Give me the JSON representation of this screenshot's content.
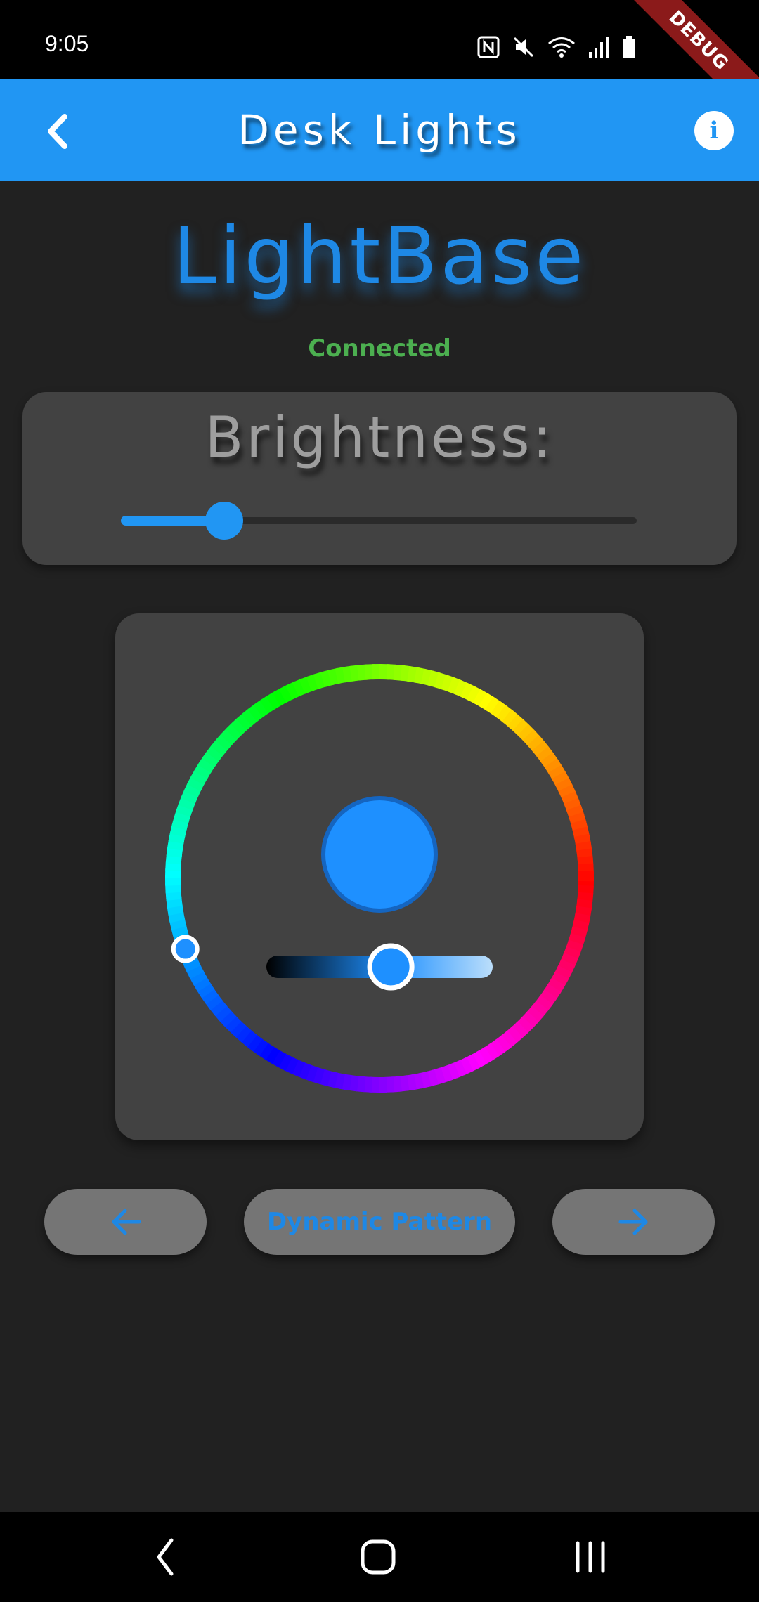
{
  "status_bar": {
    "time": "9:05",
    "icons": [
      "nfc-icon",
      "mute-icon",
      "wifi-icon",
      "signal-icon",
      "battery-icon"
    ],
    "debug_label": "DEBUG"
  },
  "app_bar": {
    "title": "Desk Lights",
    "back_icon": "chevron-left-icon",
    "info_icon": "info-icon",
    "info_glyph": "i",
    "background": "#2196f3"
  },
  "main": {
    "brand_title": "LightBase",
    "brand_color": "#1e88e5",
    "connection_status": "Connected",
    "status_color": "#4caf50"
  },
  "brightness": {
    "label": "Brightness:",
    "value": 0.2
  },
  "color_picker": {
    "hue_wheel": true,
    "selected_hue_deg": 200,
    "preview_color": "#1e90ff",
    "shade_value": 0.55
  },
  "buttons": {
    "prev_icon": "arrow-left-icon",
    "pattern_label": "Dynamic Pattern",
    "next_icon": "arrow-right-icon"
  },
  "nav_bar": {
    "icons": [
      "back-nav-icon",
      "home-nav-icon",
      "recents-nav-icon"
    ]
  }
}
